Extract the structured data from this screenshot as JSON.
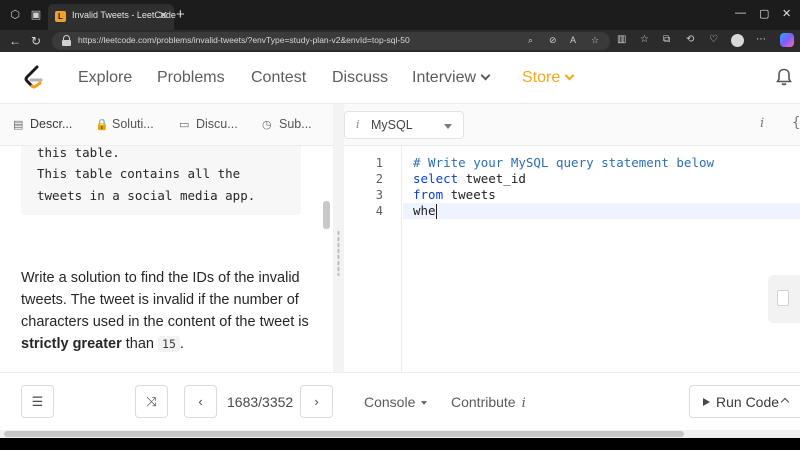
{
  "browser": {
    "tab_title": "Invalid Tweets - LeetCode",
    "tab_close": "✕",
    "new_tab": "+",
    "url": "https://leetcode.com/problems/invalid-tweets/?envType=study-plan-v2&envId=top-sql-50",
    "window_controls": [
      "—",
      "▢",
      "✕"
    ]
  },
  "nav": {
    "items": [
      {
        "label": "Explore"
      },
      {
        "label": "Problems"
      },
      {
        "label": "Contest"
      },
      {
        "label": "Discuss"
      },
      {
        "label": "Interview"
      },
      {
        "label": "Store"
      }
    ],
    "store_color": "#f5a623"
  },
  "left_tabs": [
    {
      "label": "Descr...",
      "icon": "description-icon"
    },
    {
      "label": "Soluti...",
      "icon": "lock-icon"
    },
    {
      "label": "Discu...",
      "icon": "discussion-icon"
    },
    {
      "label": "Sub...",
      "icon": "clock-icon"
    }
  ],
  "description": {
    "code_lines": [
      "this table.",
      "This table contains all the",
      "tweets in a social media app."
    ],
    "para_before_bold": "Write a solution to find the IDs of the invalid tweets. The tweet is invalid if the number of characters used in the content of the tweet is ",
    "bold": "strictly greater",
    "para_after_bold": " than ",
    "inline_code": "15",
    "para_end": "."
  },
  "editor": {
    "language_icon": "i",
    "language": "MySQL",
    "info_icon": "i",
    "brace_icon": "{",
    "line_numbers": [
      "1",
      "2",
      "3",
      "4"
    ],
    "line1": "# Write your MySQL query statement below",
    "line2_kw": "select",
    "line2_rest": " tweet_id",
    "line3_kw": "from",
    "line3_rest": " tweets",
    "line4": "whe"
  },
  "bottom": {
    "counter": "1683/3352",
    "console": "Console",
    "contribute": "Contribute",
    "contribute_icon": "i",
    "run": "Run Code"
  }
}
